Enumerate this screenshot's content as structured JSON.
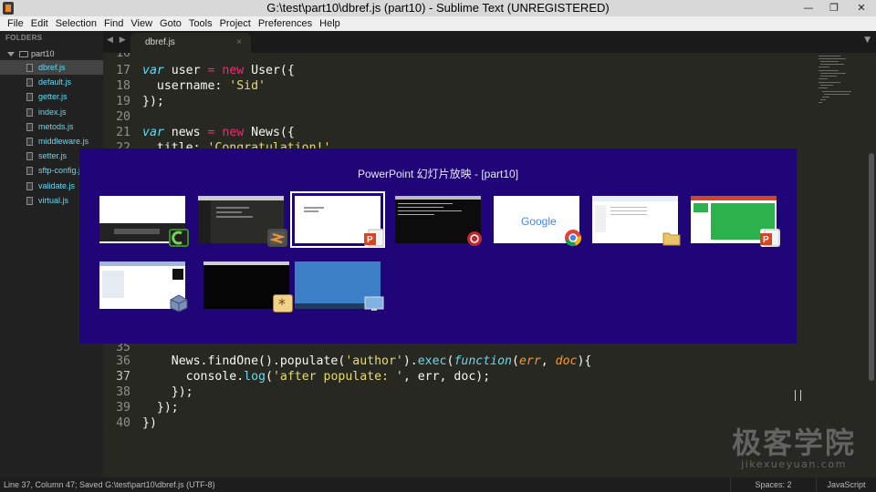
{
  "window": {
    "title": "G:\\test\\part10\\dbref.js (part10) - Sublime Text (UNREGISTERED)",
    "minimize": "—",
    "restore": "❐",
    "close": "✕"
  },
  "menu": [
    "File",
    "Edit",
    "Selection",
    "Find",
    "View",
    "Goto",
    "Tools",
    "Project",
    "Preferences",
    "Help"
  ],
  "sidebar": {
    "header": "FOLDERS",
    "folder": "part10",
    "files": [
      "dbref.js",
      "default.js",
      "getter.js",
      "index.js",
      "metods.js",
      "middleware.js",
      "setter.js",
      "sftp-config.js",
      "validate.js",
      "virtual.js"
    ],
    "active_file": "dbref.js"
  },
  "tabs": {
    "nav": "◀ ▶",
    "active": "dbref.js",
    "close": "×",
    "dropdown": "▼"
  },
  "editor": {
    "current_line": 37,
    "lines": [
      {
        "n": "16",
        "code": ""
      },
      {
        "n": "17",
        "code": ""
      },
      {
        "n": "18",
        "code": ""
      },
      {
        "n": "19",
        "code": "});"
      },
      {
        "n": "20",
        "code": ""
      },
      {
        "n": "21",
        "code": ""
      },
      {
        "n": "22",
        "code": ""
      },
      {
        "n": "35",
        "code": ""
      },
      {
        "n": "36",
        "code": ""
      },
      {
        "n": "37",
        "code": ""
      },
      {
        "n": "38",
        "code": "    });"
      },
      {
        "n": "39",
        "code": "  });"
      },
      {
        "n": "40",
        "code": "})"
      }
    ],
    "tokens": {
      "var": "var",
      "user": " user ",
      "eq": "=",
      "new": "new",
      "User": " User({",
      "username_key": "  username: ",
      "sid": "'Sid'",
      "news": " news ",
      "News": " News({",
      "title_key": "  title: ",
      "congrats": "'Congratulation!'",
      "news_find": "    News.findOne().populate(",
      "author": "'author'",
      "exec_pre": ").",
      "exec": "exec",
      "paren": "(",
      "function": "function",
      "args_open": "(",
      "err": "err",
      "comma": ", ",
      "doc": "doc",
      "args_close": "){",
      "console": "      console.",
      "log": "log",
      "log_open": "(",
      "after_pop": "'after populate: '",
      "log_rest": ", err, doc);"
    }
  },
  "switcher": {
    "title": "PowerPoint 幻灯片放映 - [part10]",
    "windows": [
      {
        "name": "camtasia",
        "icon": "camtasia-icon",
        "selected": false
      },
      {
        "name": "sublime-text",
        "icon": "sublime-icon",
        "selected": false
      },
      {
        "name": "powerpoint-slideshow",
        "icon": "powerpoint-icon",
        "selected": true
      },
      {
        "name": "terminal-mongodb",
        "icon": "cmd-icon",
        "selected": false
      },
      {
        "name": "google-chrome",
        "icon": "chrome-icon",
        "selected": false,
        "logo": "Google"
      },
      {
        "name": "file-explorer",
        "icon": "folder-icon",
        "selected": false
      },
      {
        "name": "powerpoint-editor",
        "icon": "powerpoint-icon",
        "selected": false
      },
      {
        "name": "virtualbox",
        "icon": "virtualbox-icon",
        "selected": false
      },
      {
        "name": "console-app",
        "icon": "console-icon",
        "selected": false
      },
      {
        "name": "desktop",
        "icon": "desktop-icon",
        "selected": false
      }
    ]
  },
  "statusbar": {
    "left": "Line 37, Column 47; Saved G:\\test\\part10\\dbref.js (UTF-8)",
    "spaces": "Spaces: 2",
    "syntax": "JavaScript"
  },
  "watermark": {
    "cn": "极客学院",
    "url": "jikexueyuan.com"
  },
  "colors": {
    "editor_bg": "#272822",
    "switcher_bg": "#200578",
    "keyword": "#66d9ef",
    "operator": "#f92672",
    "string": "#e6db74",
    "argument": "#fd971f"
  }
}
